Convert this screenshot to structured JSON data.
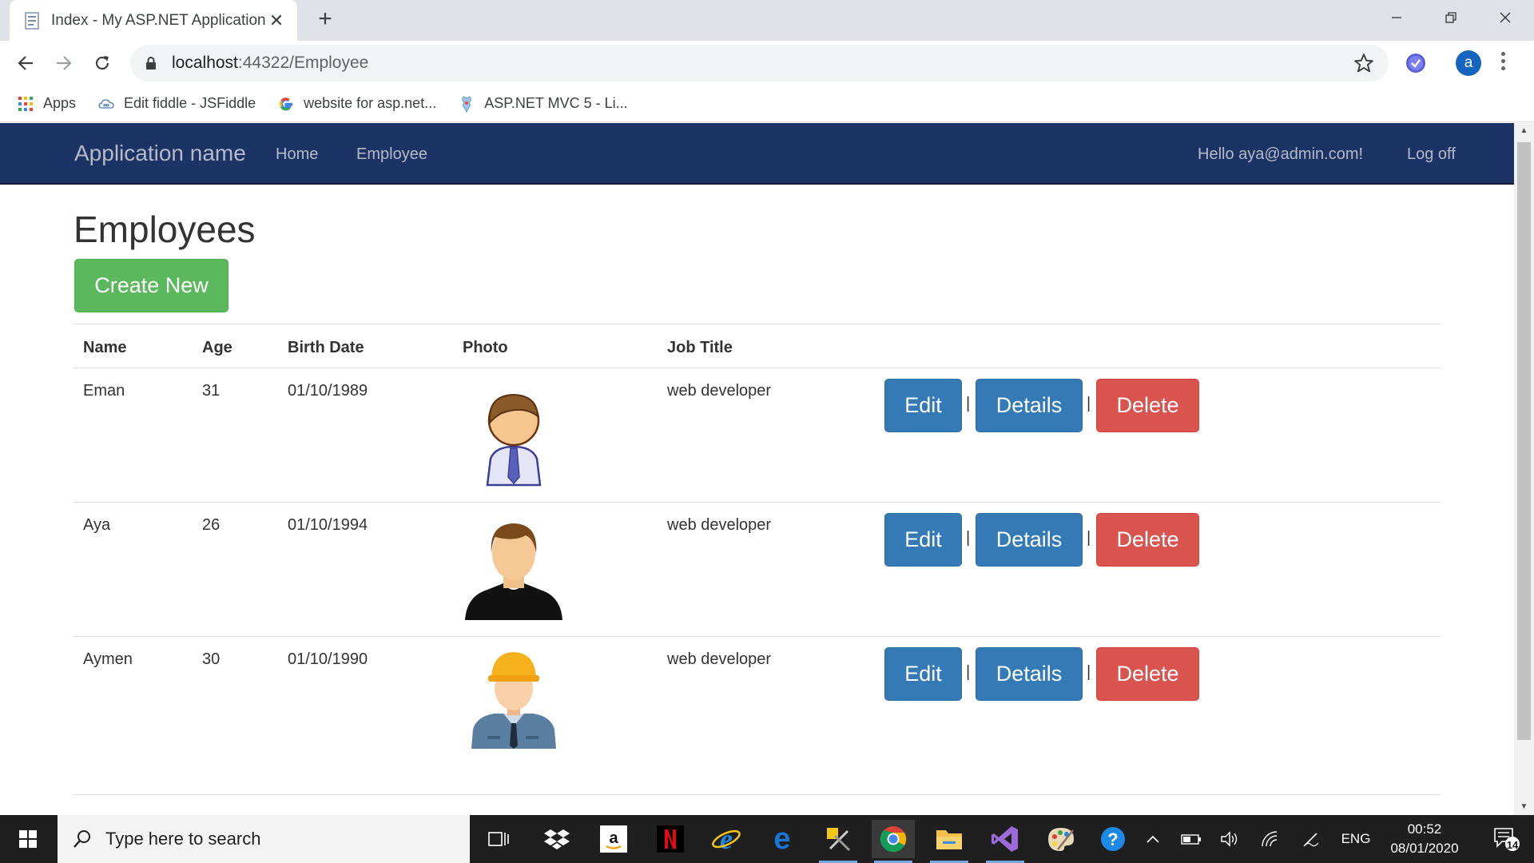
{
  "browser": {
    "tab_title": "Index - My ASP.NET Application",
    "url_host": "localhost",
    "url_path": ":44322/Employee",
    "bookmarks": [
      {
        "label": "Apps",
        "icon": "apps-grid-icon"
      },
      {
        "label": "Edit fiddle - JSFiddle",
        "icon": "jsfiddle-icon"
      },
      {
        "label": "website for asp.net...",
        "icon": "google-icon"
      },
      {
        "label": "ASP.NET MVC 5 - Li...",
        "icon": "aspnet-icon"
      }
    ],
    "profile_initial": "a"
  },
  "navbar": {
    "brand": "Application name",
    "links": [
      "Home",
      "Employee"
    ],
    "greeting": "Hello aya@admin.com!",
    "logoff": "Log off"
  },
  "page": {
    "title": "Employees",
    "create_label": "Create New",
    "columns": [
      "Name",
      "Age",
      "Birth Date",
      "Photo",
      "Job Title"
    ],
    "rows": [
      {
        "name": "Eman",
        "age": "31",
        "birth_date": "01/10/1989",
        "photo": "businessman-tie-avatar",
        "job_title": "web developer"
      },
      {
        "name": "Aya",
        "age": "26",
        "birth_date": "01/10/1994",
        "photo": "man-black-shirt-avatar",
        "job_title": "web developer"
      },
      {
        "name": "Aymen",
        "age": "30",
        "birth_date": "01/10/1990",
        "photo": "engineer-hardhat-avatar",
        "job_title": "web developer"
      }
    ],
    "actions": {
      "edit": "Edit",
      "details": "Details",
      "delete": "Delete",
      "separator": "|"
    }
  },
  "colors": {
    "navbar": "#1c3365",
    "success": "#5cb85c",
    "primary": "#337ab7",
    "danger": "#d9534f"
  },
  "taskbar": {
    "search_placeholder": "Type here to search",
    "language": "ENG",
    "time": "00:52",
    "date": "08/01/2020",
    "notifications": "14"
  }
}
